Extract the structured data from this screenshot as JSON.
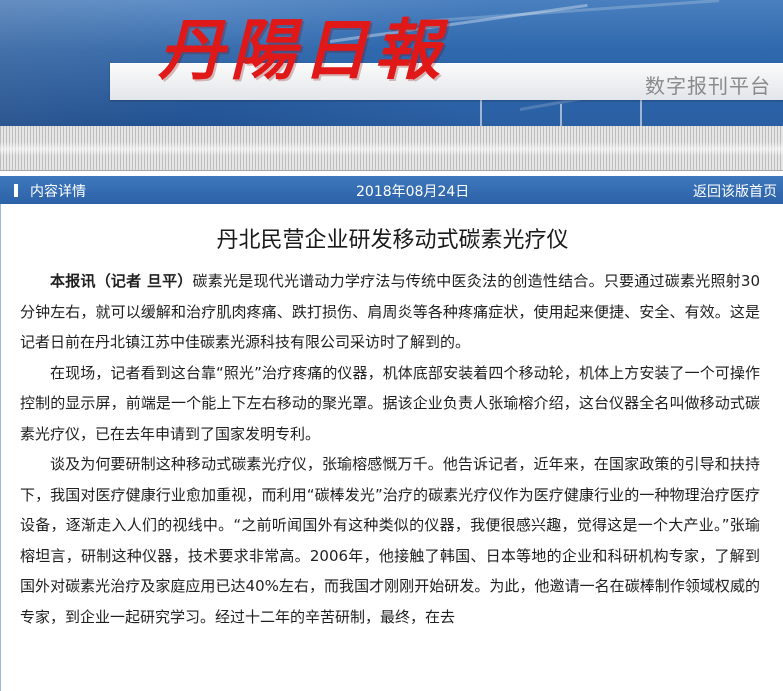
{
  "header": {
    "logo_text": "丹陽日報",
    "platform_text": "数字报刊平台"
  },
  "infobar": {
    "label": "内容详情",
    "date": "2018年08月24日",
    "back_link": "返回该版首页"
  },
  "article": {
    "title": "丹北民营企业研发移动式碳素光疗仪",
    "lead": "本报讯（记者 旦平）",
    "paragraphs": [
      "碳素光是现代光谱动力学疗法与传统中医灸法的创造性结合。只要通过碳素光照射30分钟左右，就可以缓解和治疗肌肉疼痛、跌打损伤、肩周炎等各种疼痛症状，使用起来便捷、安全、有效。这是记者日前在丹北镇江苏中佳碳素光源科技有限公司采访时了解到的。",
      "在现场，记者看到这台靠“照光”治疗疼痛的仪器，机体底部安装着四个移动轮，机体上方安装了一个可操作控制的显示屏，前端是一个能上下左右移动的聚光罩。据该企业负责人张瑜榕介绍，这台仪器全名叫做移动式碳素光疗仪，已在去年申请到了国家发明专利。",
      "谈及为何要研制这种移动式碳素光疗仪，张瑜榕感慨万千。他告诉记者，近年来，在国家政策的引导和扶持下，我国对医疗健康行业愈加重视，而利用“碳棒发光”治疗的碳素光疗仪作为医疗健康行业的一种物理治疗医疗设备，逐渐走入人们的视线中。“之前听闻国外有这种类似的仪器，我便很感兴趣，觉得这是一个大产业。”张瑜榕坦言，研制这种仪器，技术要求非常高。2006年，他接触了韩国、日本等地的企业和科研机构专家，了解到国外对碳素光治疗及家庭应用已达40%左右，而我国才刚刚开始研发。为此，他邀请一名在碳棒制作领域权威的专家，到企业一起研究学习。经过十二年的辛苦研制，最终，在去"
    ]
  },
  "colors": {
    "banner_blue": "#2f68ad",
    "logo_red": "#e01818",
    "infobar_blue": "#2c62a7"
  }
}
